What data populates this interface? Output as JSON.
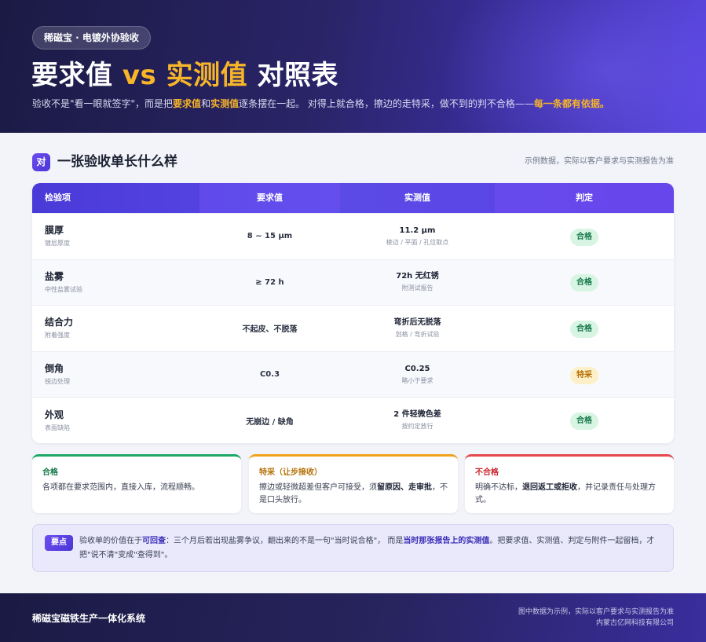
{
  "header": {
    "pill": "稀磁宝 · 电镀外协验收",
    "title_part1": "要求值",
    "title_vs": "vs",
    "title_part2": "实测值",
    "title_part3": "对照表",
    "sub_1": "验收不是\"看一眼就签字\"，而是把",
    "sub_req": "要求值",
    "sub_and": "和",
    "sub_meas": "实测值",
    "sub_2": "逐条摆在一起。 对得上就合格，擦边的走特采，做不到的判不合格——",
    "sub_hl": "每一条都有依据。"
  },
  "section": {
    "badge": "对",
    "title": "一张验收单长什么样",
    "note": "示例数据，实际以客户要求与实测报告为准"
  },
  "table": {
    "headers": [
      "检验项",
      "要求值",
      "实测值",
      "判定"
    ],
    "rows": [
      {
        "name": "膜厚",
        "sub": "镀层厚度",
        "req": "8 ~ 15 μm",
        "meas": "11.2 μm",
        "meas_sub": "棱边 / 平面 / 孔位取点",
        "verdict": "合格"
      },
      {
        "name": "盐雾",
        "sub": "中性盐雾试验",
        "req": "≥ 72 h",
        "meas": "72h 无红锈",
        "meas_sub": "附测试报告",
        "verdict": "合格"
      },
      {
        "name": "结合力",
        "sub": "附着强度",
        "req": "不起皮、不脱落",
        "meas": "弯折后无脱落",
        "meas_sub": "划格 / 弯折试验",
        "verdict": "合格"
      },
      {
        "name": "倒角",
        "sub": "锐边处理",
        "req": "C0.3",
        "meas": "C0.25",
        "meas_sub": "略小于要求",
        "verdict": "特采"
      },
      {
        "name": "外观",
        "sub": "表面缺陷",
        "req": "无崩边 / 缺角",
        "meas": "2 件轻微色差",
        "meas_sub": "按约定放行",
        "verdict": "合格"
      }
    ]
  },
  "legend": {
    "ok": {
      "title": "合格",
      "body": "各项都在要求范围内，直接入库，流程顺畅。"
    },
    "warn": {
      "title": "特采（让步接收）",
      "body_1": "擦边或轻微超差但客户可接受，须",
      "body_b1": "留原因、走审批",
      "body_2": "，不是口头放行。"
    },
    "bad": {
      "title": "不合格",
      "body_1": "明确不达标，",
      "body_b1": "退回返工或拒收",
      "body_2": "，并记录责任与处理方式。"
    }
  },
  "keynote": {
    "tag": "要点",
    "t1": "验收单的价值在于",
    "b1": "可回查",
    "t2": "：三个月后若出现盐雾争议，翻出来的不是一句\"当时说合格\"， 而是",
    "b2": "当时那张报告上的实测值",
    "t3": "。把要求值、实测值、判定与附件一起留档，才把\"说不清\"变成\"查得到\"。"
  },
  "footer": {
    "brand": "稀磁宝磁铁生产一体化系统",
    "note": "图中数据为示例，实际以客户要求与实测报告为准",
    "company": "内蒙古亿网科技有限公司"
  },
  "colors": {
    "accent": "#4a36d6",
    "highlight": "#f7b529",
    "ok": "#16794a",
    "warn": "#b5720a",
    "bad": "#c8262c"
  }
}
